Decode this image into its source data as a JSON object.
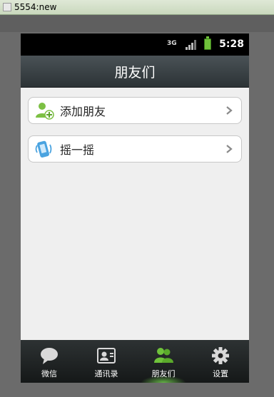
{
  "window": {
    "title": "5554:new"
  },
  "status": {
    "network": "3G",
    "time": "5:28"
  },
  "header": {
    "title": "朋友们"
  },
  "items": [
    {
      "label": "添加朋友",
      "icon": "add-friend-icon"
    },
    {
      "label": "摇一摇",
      "icon": "shake-icon"
    }
  ],
  "tabs": [
    {
      "label": "微信",
      "icon": "chat-bubble-icon",
      "active": false
    },
    {
      "label": "通讯录",
      "icon": "contacts-card-icon",
      "active": false
    },
    {
      "label": "朋友们",
      "icon": "friends-icon",
      "active": true
    },
    {
      "label": "设置",
      "icon": "gear-icon",
      "active": false
    }
  ],
  "colors": {
    "active_tab": "#6fc23b",
    "header_bg": "#3a4245",
    "content_bg": "#efefef"
  }
}
